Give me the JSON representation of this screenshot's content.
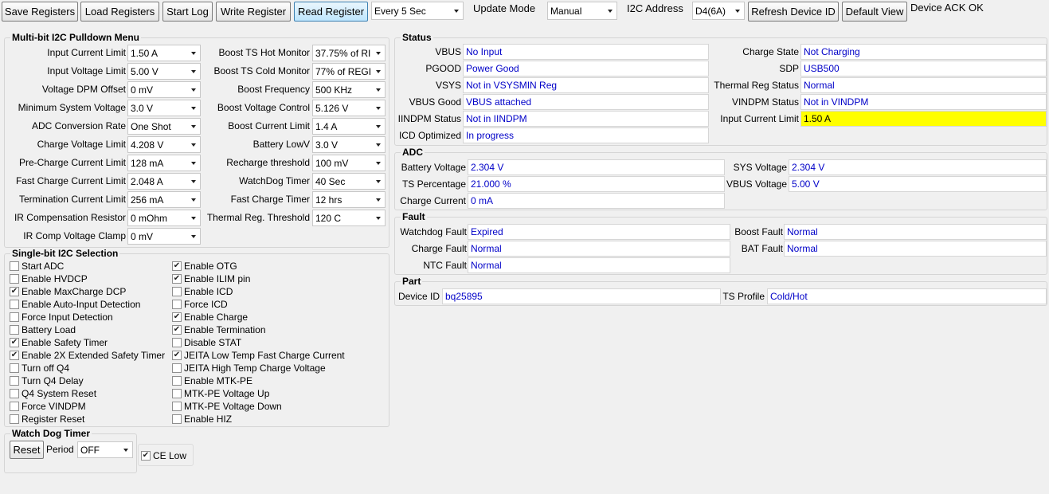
{
  "toolbar": {
    "save_registers": "Save Registers",
    "load_registers": "Load Registers",
    "start_log": "Start Log",
    "write_register": "Write Register",
    "read_register": "Read Register",
    "interval": "Every 5 Sec",
    "update_mode_label": "Update Mode",
    "update_mode": "Manual",
    "i2c_address_label": "I2C Address",
    "i2c_address": "D4(6A)",
    "refresh_device_id": "Refresh Device ID",
    "default_view": "Default View",
    "device_status": "Device ACK OK"
  },
  "multibit": {
    "title": "Multi-bit I2C Pulldown Menu",
    "left": [
      {
        "label": "Input Current Limit",
        "value": "1.50 A"
      },
      {
        "label": "Input Voltage Limit",
        "value": "5.00 V"
      },
      {
        "label": "Voltage DPM Offset",
        "value": "0 mV"
      },
      {
        "label": "Minimum System Voltage",
        "value": "3.0 V"
      },
      {
        "label": "ADC Conversion Rate",
        "value": "One Shot"
      },
      {
        "label": "Charge Voltage Limit",
        "value": "4.208 V"
      },
      {
        "label": "Pre-Charge Current Limit",
        "value": "128 mA"
      },
      {
        "label": "Fast Charge Current Limit",
        "value": "2.048 A"
      },
      {
        "label": "Termination Current Limit",
        "value": "256 mA"
      },
      {
        "label": "IR Compensation Resistor",
        "value": "0 mOhm"
      },
      {
        "label": "IR Comp Voltage Clamp",
        "value": "0 mV"
      }
    ],
    "right": [
      {
        "label": "Boost TS Hot Monitor",
        "value": "37.75% of RI"
      },
      {
        "label": "Boost TS Cold Monitor",
        "value": "77% of REGI"
      },
      {
        "label": "Boost Frequency",
        "value": "500 KHz"
      },
      {
        "label": "Boost Voltage Control",
        "value": "5.126 V"
      },
      {
        "label": "Boost Current Limit",
        "value": "1.4 A"
      },
      {
        "label": "Battery LowV",
        "value": "3.0 V"
      },
      {
        "label": "Recharge threshold",
        "value": "100 mV"
      },
      {
        "label": "WatchDog Timer",
        "value": "40 Sec"
      },
      {
        "label": "Fast Charge Timer",
        "value": "12 hrs"
      },
      {
        "label": "Thermal Reg. Threshold",
        "value": "120 C"
      }
    ]
  },
  "singlebit": {
    "title": "Single-bit I2C Selection",
    "left": [
      {
        "label": "Start ADC",
        "checked": false
      },
      {
        "label": "Enable HVDCP",
        "checked": false
      },
      {
        "label": "Enable MaxCharge DCP",
        "checked": true
      },
      {
        "label": "Enable Auto-Input Detection",
        "checked": false
      },
      {
        "label": "Force Input Detection",
        "checked": false
      },
      {
        "label": "Battery Load",
        "checked": false
      },
      {
        "label": "Enable Safety Timer",
        "checked": true
      },
      {
        "label": "Enable 2X Extended Safety Timer",
        "checked": true
      },
      {
        "label": "Turn off Q4",
        "checked": false
      },
      {
        "label": "Turn Q4 Delay",
        "checked": false
      },
      {
        "label": "Q4 System Reset",
        "checked": false
      },
      {
        "label": "Force VINDPM",
        "checked": false
      },
      {
        "label": "Register Reset",
        "checked": false
      }
    ],
    "right": [
      {
        "label": "Enable OTG",
        "checked": true
      },
      {
        "label": "Enable ILIM pin",
        "checked": true
      },
      {
        "label": "Enable ICD",
        "checked": false
      },
      {
        "label": "Force ICD",
        "checked": false
      },
      {
        "label": "Enable Charge",
        "checked": true
      },
      {
        "label": "Enable Termination",
        "checked": true
      },
      {
        "label": "Disable STAT",
        "checked": false
      },
      {
        "label": "JEITA Low Temp Fast Charge Current",
        "checked": true
      },
      {
        "label": "JEITA High Temp Charge Voltage",
        "checked": false
      },
      {
        "label": "Enable MTK-PE",
        "checked": false
      },
      {
        "label": "MTK-PE Voltage Up",
        "checked": false
      },
      {
        "label": "MTK-PE Voltage Down",
        "checked": false
      },
      {
        "label": "Enable HIZ",
        "checked": false
      }
    ]
  },
  "watchdog": {
    "title": "Watch Dog Timer",
    "reset": "Reset",
    "period_label": "Period",
    "period": "OFF",
    "ce_low": "CE Low",
    "ce_low_checked": true
  },
  "status": {
    "title": "Status",
    "left": [
      {
        "label": "VBUS",
        "value": "No Input"
      },
      {
        "label": "PGOOD",
        "value": "Power Good"
      },
      {
        "label": "VSYS",
        "value": "Not in VSYSMIN Reg"
      },
      {
        "label": "VBUS Good",
        "value": "VBUS attached"
      },
      {
        "label": "IINDPM Status",
        "value": "Not in IINDPM"
      },
      {
        "label": "ICD Optimized",
        "value": "In progress"
      }
    ],
    "right": [
      {
        "label": "Charge State",
        "value": "Not Charging"
      },
      {
        "label": "SDP",
        "value": "USB500"
      },
      {
        "label": "Thermal Reg Status",
        "value": "Normal"
      },
      {
        "label": "VINDPM Status",
        "value": "Not in VINDPM"
      },
      {
        "label": "Input Current Limit",
        "value": "1.50 A"
      }
    ]
  },
  "adc": {
    "title": "ADC",
    "left": [
      {
        "label": "Battery Voltage",
        "value": "2.304 V"
      },
      {
        "label": "TS Percentage",
        "value": "21.000 %"
      },
      {
        "label": "Charge Current",
        "value": "0 mA"
      }
    ],
    "right": [
      {
        "label": "SYS Voltage",
        "value": "2.304 V"
      },
      {
        "label": "VBUS Voltage",
        "value": "5.00 V"
      }
    ]
  },
  "fault": {
    "title": "Fault",
    "left": [
      {
        "label": "Watchdog Fault",
        "value": "Expired"
      },
      {
        "label": "Charge Fault",
        "value": "Normal"
      },
      {
        "label": "NTC Fault",
        "value": "Normal"
      }
    ],
    "right": [
      {
        "label": "Boost Fault",
        "value": "Normal"
      },
      {
        "label": "BAT Fault",
        "value": "Normal"
      }
    ]
  },
  "part": {
    "title": "Part",
    "device_id_label": "Device ID",
    "device_id": "bq25895",
    "ts_profile_label": "TS Profile",
    "ts_profile": "Cold/Hot"
  }
}
